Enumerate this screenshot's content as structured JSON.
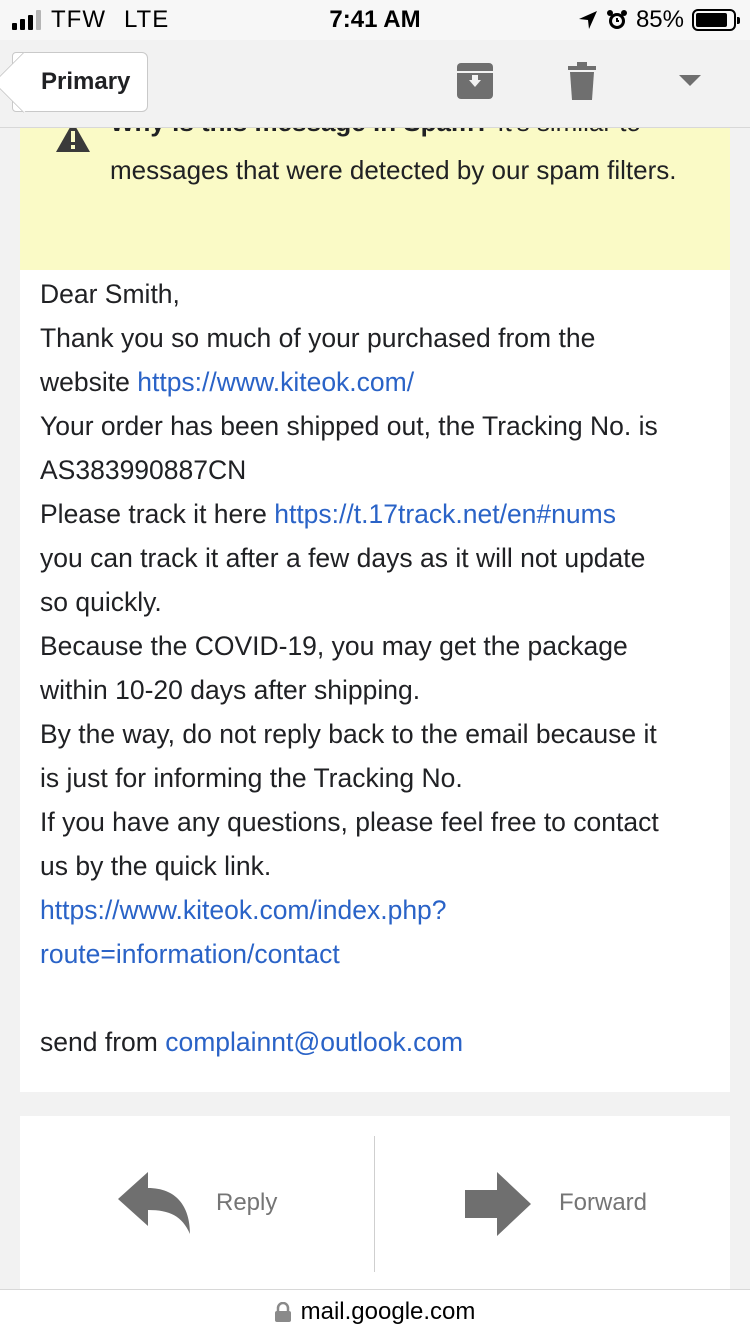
{
  "status_bar": {
    "carrier": "TFW",
    "network": "LTE",
    "time": "7:41 AM",
    "battery": "85%",
    "battery_level": 0.85
  },
  "toolbar": {
    "back_label": "Primary",
    "icons": [
      "archive-icon",
      "trash-icon",
      "more-options-icon"
    ]
  },
  "spam_warning": {
    "title": "Why is this message in Spam?",
    "text": "It's similar to messages that were detected by our spam filters."
  },
  "email": {
    "greeting": "Dear Smith,",
    "line1": "Thank you so much of your purchased from the",
    "line2_prefix": "website",
    "line2_link": "https://www.kiteok.com/",
    "line3": "Your order has been shipped out, the Tracking No. is",
    "tracking_number": "AS383990887CN",
    "line5_prefix": "Please track it here",
    "line5_link": "https://t.17track.net/en#nums",
    "line6": "you can track it after a few days as it will not update",
    "line7": "so quickly.",
    "line8": "Because the COVID-19, you may get the package",
    "line9": "within 10-20 days after shipping.",
    "line10": "By the way, do not reply back to the email because it",
    "line11": "is just for informing the Tracking No.",
    "line12": "If you have any questions, please feel free to contact",
    "line13": "us by the quick link.",
    "contact_link_1": "https://www.kiteok.com/index.php?",
    "contact_link_2": "route=information/contact",
    "send_prefix": "send from",
    "send_email": "complainnt@outlook.com"
  },
  "actions": {
    "reply_label": "Reply",
    "forward_label": "Forward"
  },
  "url_bar": {
    "domain": "mail.google.com"
  },
  "colors": {
    "link": "#2a63c7",
    "spam_banner_bg": "#fafac6",
    "icon_gray": "#6f6f6f"
  }
}
